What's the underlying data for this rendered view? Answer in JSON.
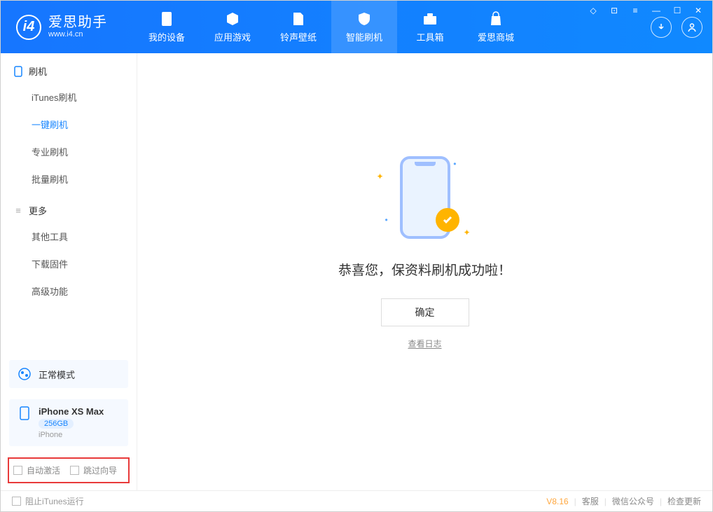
{
  "app": {
    "title": "爱思助手",
    "subtitle": "www.i4.cn"
  },
  "nav": {
    "tabs": [
      {
        "label": "我的设备"
      },
      {
        "label": "应用游戏"
      },
      {
        "label": "铃声壁纸"
      },
      {
        "label": "智能刷机"
      },
      {
        "label": "工具箱"
      },
      {
        "label": "爱思商城"
      }
    ],
    "active_index": 3
  },
  "sidebar": {
    "sections": [
      {
        "title": "刷机",
        "items": [
          "iTunes刷机",
          "一键刷机",
          "专业刷机",
          "批量刷机"
        ],
        "active_index": 1
      },
      {
        "title": "更多",
        "items": [
          "其他工具",
          "下载固件",
          "高级功能"
        ],
        "active_index": -1
      }
    ],
    "mode": {
      "label": "正常模式"
    },
    "device": {
      "name": "iPhone XS Max",
      "storage": "256GB",
      "type": "iPhone"
    },
    "options": [
      {
        "label": "自动激活",
        "checked": false
      },
      {
        "label": "跳过向导",
        "checked": false
      }
    ]
  },
  "main": {
    "success_text": "恭喜您，保资料刷机成功啦！",
    "ok_button": "确定",
    "view_log": "查看日志"
  },
  "statusbar": {
    "block_itunes": "阻止iTunes运行",
    "version": "V8.16",
    "links": [
      "客服",
      "微信公众号",
      "检查更新"
    ]
  }
}
